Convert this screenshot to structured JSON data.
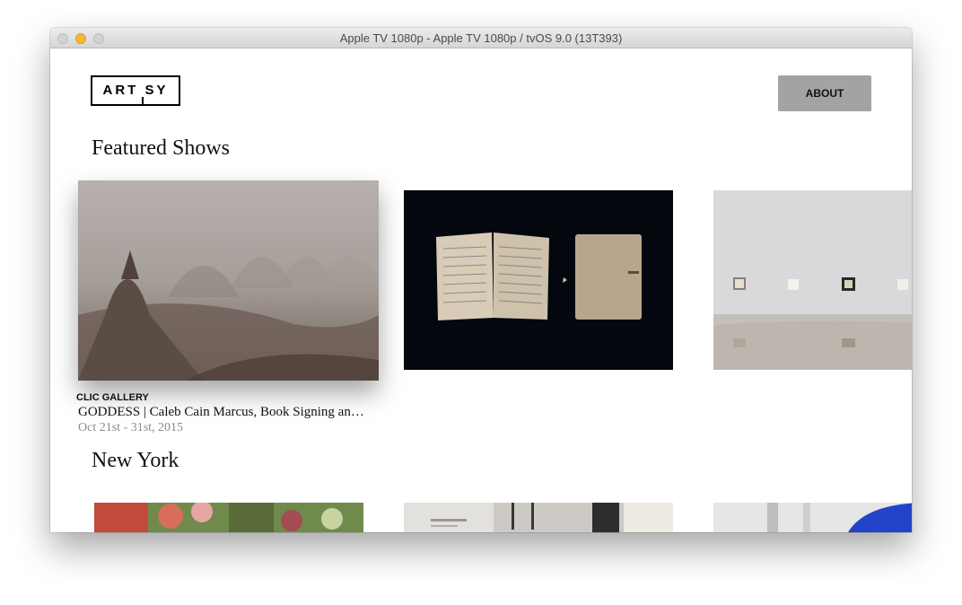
{
  "window": {
    "title": "Apple TV 1080p - Apple TV 1080p / tvOS 9.0 (13T393)"
  },
  "header": {
    "logo_text": "ART SY",
    "about_label": "ABOUT"
  },
  "sections": [
    {
      "title": "Featured Shows",
      "focused_card": {
        "partner": "CLIC GALLERY",
        "name": "GODDESS | Caleb Cain Marcus, Book Signing an…",
        "dates": "Oct 21st - 31st, 2015"
      }
    },
    {
      "title": "New York"
    }
  ],
  "colors": {
    "about_button_bg": "#a3a3a3",
    "date_text": "#8a8a8a",
    "traffic_minimize": "#f4b73a"
  }
}
